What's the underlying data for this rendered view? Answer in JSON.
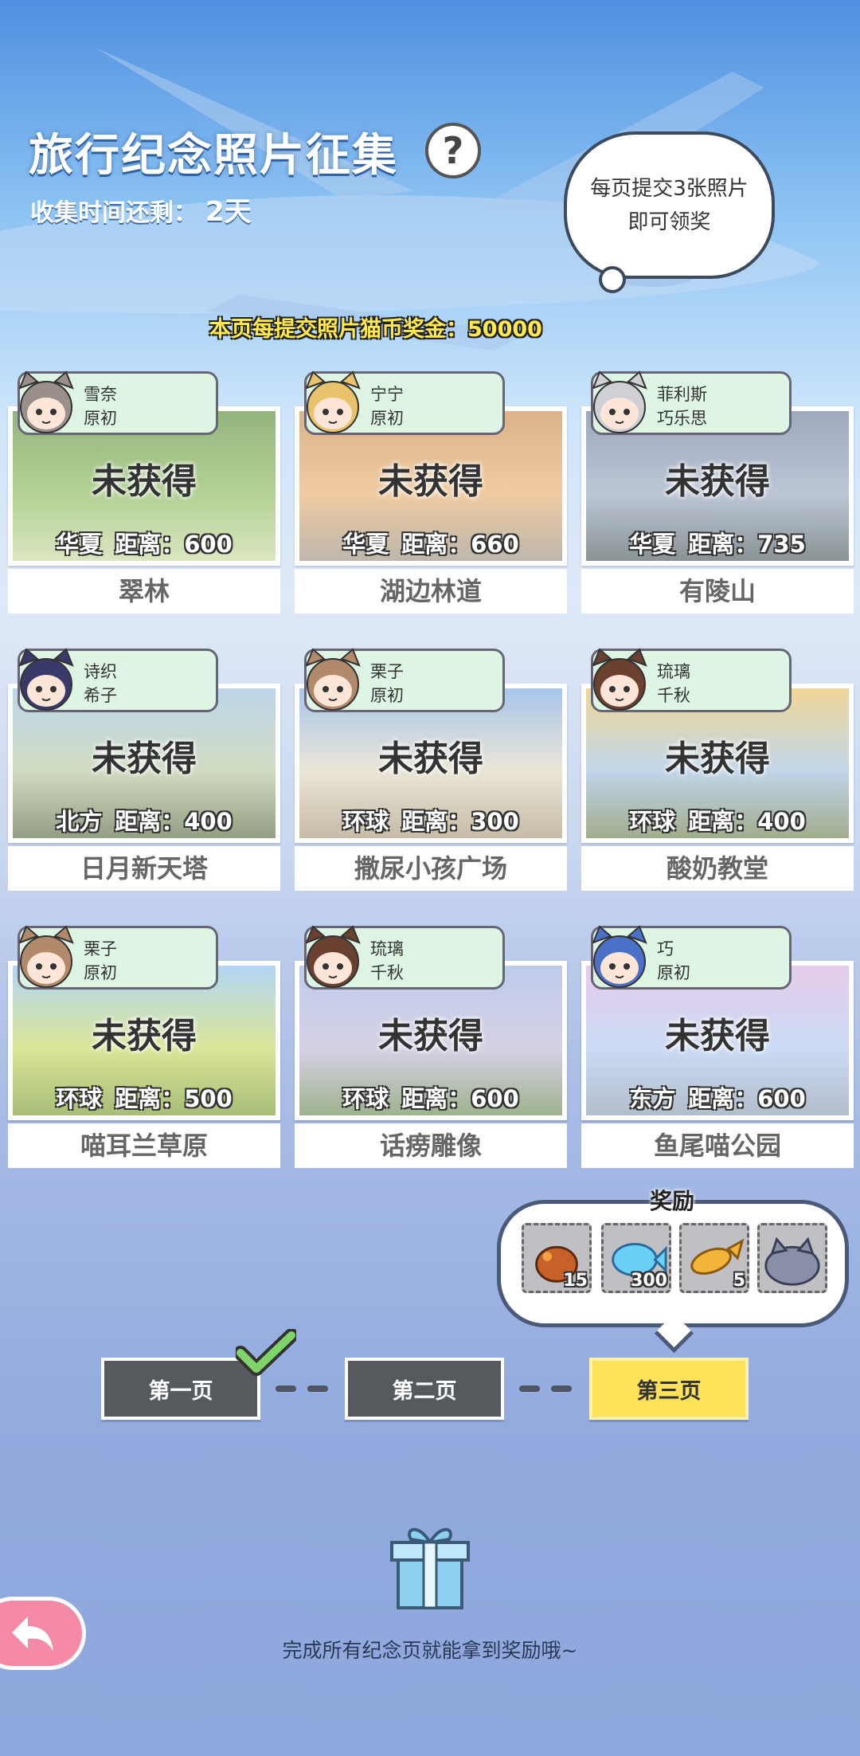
{
  "header": {
    "title": "旅行纪念照片征集",
    "help_symbol": "?",
    "timer_label": "收集时间还剩：",
    "timer_value": "2天",
    "bubble_line1": "每页提交3张照片",
    "bubble_line2": "即可领奖",
    "reward_note": "本页每提交照片猫币奖金：50000"
  },
  "cards": [
    {
      "char_line1": "雪奈",
      "char_line2": "原初",
      "status": "未获得",
      "region": "华夏",
      "distance": "距离：600",
      "place": "翠林",
      "avatar_color": "#9a8f8a",
      "photo_colors": [
        "#5a8f3a",
        "#8ab85a",
        "#c8d8a0"
      ]
    },
    {
      "char_line1": "宁宁",
      "char_line2": "原初",
      "status": "未获得",
      "region": "华夏",
      "distance": "距离：660",
      "place": "湖边林道",
      "avatar_color": "#e9c36b",
      "photo_colors": [
        "#c88a4a",
        "#e8b070",
        "#9a9080"
      ]
    },
    {
      "char_line1": "菲利斯",
      "char_line2": "巧乐思",
      "status": "未获得",
      "region": "华夏",
      "distance": "距离：735",
      "place": "有陵山",
      "avatar_color": "#cfcfd6",
      "photo_colors": [
        "#6a7a9a",
        "#9aa8c0",
        "#4a5a5a"
      ]
    },
    {
      "char_line1": "诗织",
      "char_line2": "希子",
      "status": "未获得",
      "region": "北方",
      "distance": "距离：400",
      "place": "日月新天塔",
      "avatar_color": "#3a3a6a",
      "photo_colors": [
        "#9ac0e0",
        "#b8c8a0",
        "#5a6a40"
      ]
    },
    {
      "char_line1": "栗子",
      "char_line2": "原初",
      "status": "未获得",
      "region": "环球",
      "distance": "距离：300",
      "place": "撒尿小孩广场",
      "avatar_color": "#b08a6a",
      "photo_colors": [
        "#7aa8e0",
        "#e0d8c0",
        "#a89878"
      ]
    },
    {
      "char_line1": "琉璃",
      "char_line2": "千秋",
      "status": "未获得",
      "region": "环球",
      "distance": "距离：400",
      "place": "酸奶教堂",
      "avatar_color": "#6a4030",
      "photo_colors": [
        "#e8c060",
        "#a0c0e0",
        "#708050"
      ]
    },
    {
      "char_line1": "栗子",
      "char_line2": "原初",
      "status": "未获得",
      "region": "环球",
      "distance": "距离：500",
      "place": "喵耳兰草原",
      "avatar_color": "#b08a6a",
      "photo_colors": [
        "#8ac0f0",
        "#c8d860",
        "#7a9a30"
      ]
    },
    {
      "char_line1": "琉璃",
      "char_line2": "千秋",
      "status": "未获得",
      "region": "环球",
      "distance": "距离：600",
      "place": "话痨雕像",
      "avatar_color": "#6a4030",
      "photo_colors": [
        "#9ab0e0",
        "#c0b8d8",
        "#6a8a50"
      ]
    },
    {
      "char_line1": "巧",
      "char_line2": "原初",
      "status": "未获得",
      "region": "东方",
      "distance": "距离：600",
      "place": "鱼尾喵公园",
      "avatar_color": "#4a70c8",
      "photo_colors": [
        "#d8b0e0",
        "#b0c8f0",
        "#8a9ab0"
      ]
    }
  ],
  "rewards": {
    "title": "奖励",
    "items": [
      {
        "icon": "treasure-bag-icon",
        "count": "15"
      },
      {
        "icon": "blue-fish-icon",
        "count": "300"
      },
      {
        "icon": "golden-fish-icon",
        "count": "5"
      },
      {
        "icon": "cat-cushion-icon",
        "count": ""
      }
    ]
  },
  "pages": {
    "page1": "第一页",
    "page2": "第二页",
    "page3": "第三页"
  },
  "footer": {
    "completion_text": "完成所有纪念页就能拿到奖励哦~"
  }
}
